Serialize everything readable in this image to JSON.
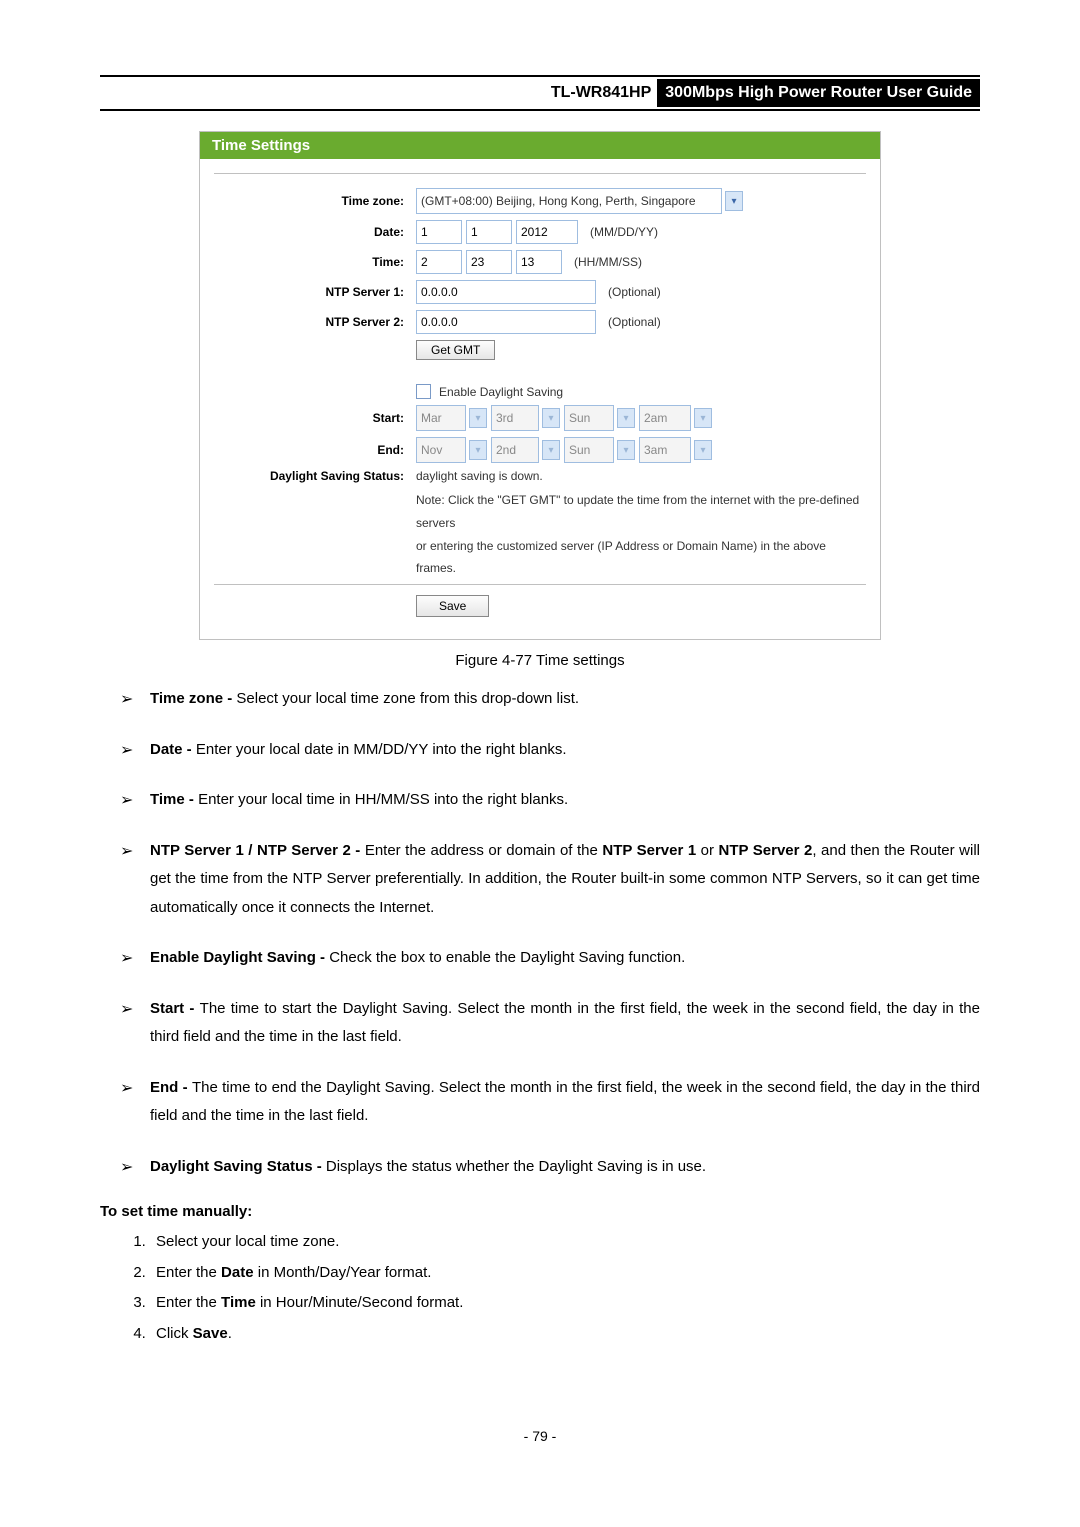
{
  "header": {
    "model": "TL-WR841HP",
    "title": "300Mbps High Power Router User Guide"
  },
  "panel": {
    "title": "Time Settings",
    "rows": {
      "timezone": {
        "label": "Time zone:",
        "value": "(GMT+08:00) Beijing, Hong Kong, Perth, Singapore"
      },
      "date": {
        "label": "Date:",
        "mm": "1",
        "dd": "1",
        "yy": "2012",
        "hint": "(MM/DD/YY)"
      },
      "time": {
        "label": "Time:",
        "hh": "2",
        "mm": "23",
        "ss": "13",
        "hint": "(HH/MM/SS)"
      },
      "ntp1": {
        "label": "NTP Server 1:",
        "value": "0.0.0.0",
        "hint": "(Optional)"
      },
      "ntp2": {
        "label": "NTP Server 2:",
        "value": "0.0.0.0",
        "hint": "(Optional)"
      },
      "getgmt": "Get GMT",
      "dlcheck": "Enable Daylight Saving",
      "start": {
        "label": "Start:",
        "m": "Mar",
        "w": "3rd",
        "d": "Sun",
        "t": "2am"
      },
      "end": {
        "label": "End:",
        "m": "Nov",
        "w": "2nd",
        "d": "Sun",
        "t": "3am"
      },
      "status": {
        "label": "Daylight Saving Status:",
        "value": "daylight saving is down."
      }
    },
    "note1": "Note: Click the \"GET GMT\" to update the time from the internet with the pre-defined servers",
    "note2": "or entering the customized server (IP Address or Domain Name) in the above frames.",
    "save": "Save"
  },
  "caption": "Figure 4-77    Time settings",
  "bullets": {
    "b1": {
      "t": "Time zone - ",
      "d": "Select your local time zone from this drop-down list."
    },
    "b2": {
      "t": "Date - ",
      "d": "Enter your local date in MM/DD/YY into the right blanks."
    },
    "b3": {
      "t": "Time - ",
      "d": "Enter your local time in HH/MM/SS into the right blanks."
    },
    "b4": {
      "t1": "NTP Server 1 / NTP Server 2 - ",
      "d1": "Enter the address or domain of the ",
      "t2": "NTP Server 1",
      "d2": " or ",
      "t3": "NTP Server 2",
      "d3": ", and then the Router will get the time from the NTP Server preferentially. In addition, the Router built-in some common NTP Servers, so it can get time automatically once it connects the Internet."
    },
    "b5": {
      "t": "Enable Daylight Saving - ",
      "d": "Check the box to enable the Daylight Saving function."
    },
    "b6": {
      "t": "Start - ",
      "d": "The time to start the Daylight Saving. Select the month in the first field, the week in the second field, the day in the third field and the time in the last field."
    },
    "b7": {
      "t": "End - ",
      "d": "The time to end the Daylight Saving. Select the month in the first field, the week in the second field, the day in the third field and the time in the last field."
    },
    "b8": {
      "t": "Daylight Saving Status - ",
      "d": "Displays the status whether the Daylight Saving is in use."
    }
  },
  "manual": {
    "heading": "To set time manually:",
    "s1a": "Select your local time zone.",
    "s2a": "Enter the ",
    "s2b": "Date",
    "s2c": " in Month/Day/Year format.",
    "s3a": "Enter the ",
    "s3b": "Time",
    "s3c": " in Hour/Minute/Second format.",
    "s4a": "Click ",
    "s4b": "Save",
    "s4c": "."
  },
  "page_number": "- 79 -"
}
